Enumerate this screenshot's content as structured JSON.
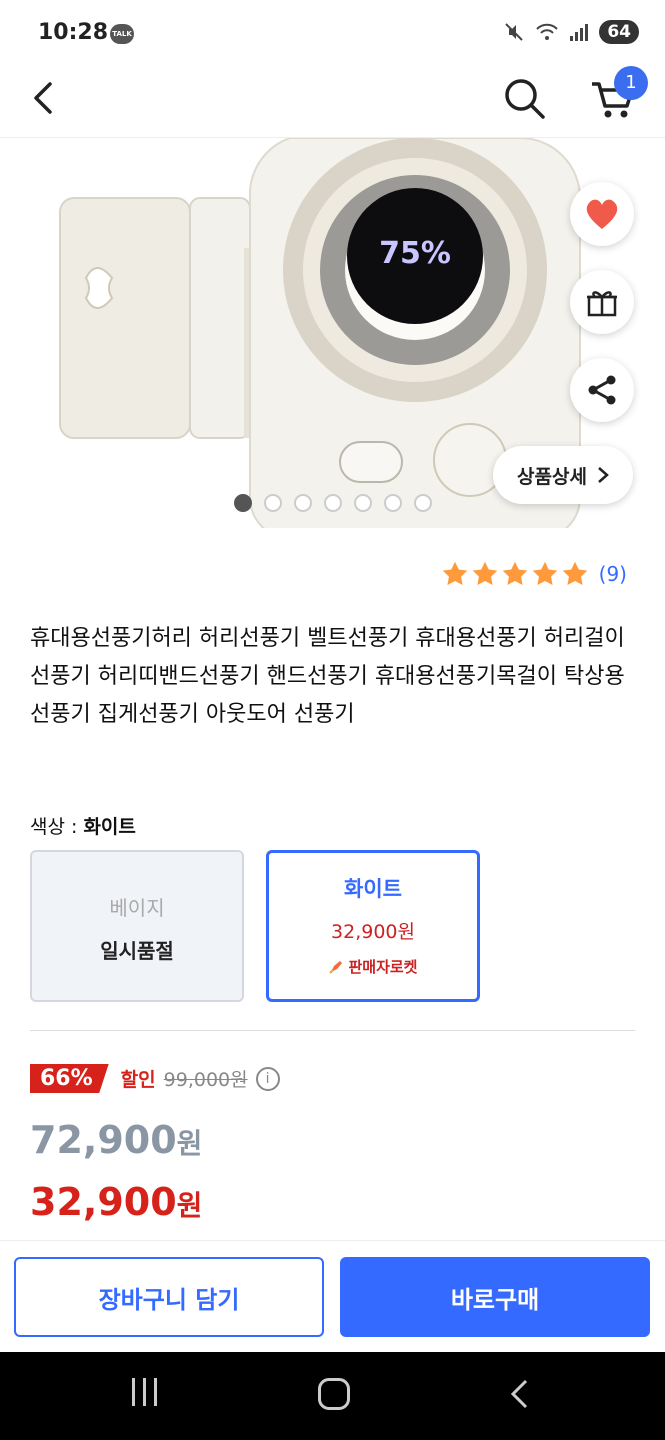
{
  "status_bar": {
    "time": "10:28",
    "talk_badge": "TALK",
    "battery": "64"
  },
  "header": {
    "cart_count": "1"
  },
  "hero": {
    "fan_display": "75%",
    "detail_button_label": "상품상세",
    "slide_count": 7,
    "active_slide": 1
  },
  "rating": {
    "stars": 5,
    "count_text": "(9)"
  },
  "product": {
    "title": "휴대용선풍기허리 허리선풍기 벨트선풍기 휴대용선풍기 허리걸이선풍기 허리띠밴드선풍기 핸드선풍기 휴대용선풍기목걸이 탁상용 선풍기 집게선풍기 아웃도어 선풍기"
  },
  "color_selector": {
    "label_prefix": "색상 : ",
    "selected_value": "화이트",
    "options": [
      {
        "name": "베이지",
        "status": "일시품절"
      },
      {
        "name": "화이트",
        "price": "32,900원",
        "delivery": "판매자로켓"
      }
    ]
  },
  "pricing": {
    "discount_percent": "66%",
    "discount_label": "할인",
    "original_price": "99,000원",
    "list_price": "72,900",
    "sale_price": "32,900",
    "currency": "원"
  },
  "footer": {
    "cart_button": "장바구니 담기",
    "buy_button": "바로구매"
  },
  "colors": {
    "accent": "#346aff",
    "sale": "#d6221b",
    "star": "#ff9a3c"
  }
}
